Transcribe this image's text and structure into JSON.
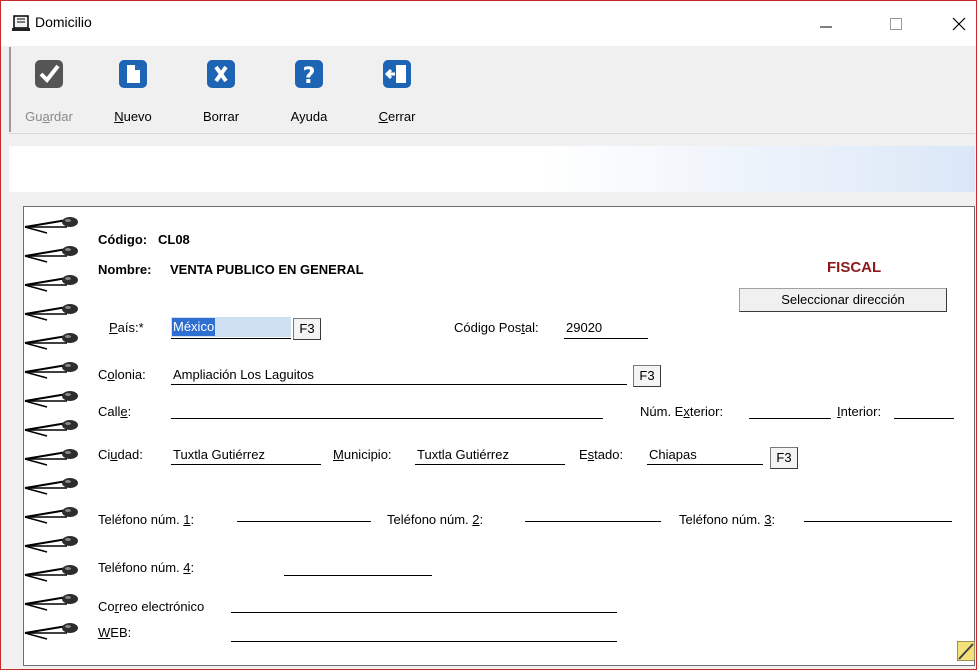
{
  "window": {
    "title": "Domicilio"
  },
  "toolbar": {
    "guardar": "Guardar",
    "nuevo": "Nuevo",
    "borrar": "Borrar",
    "ayuda": "Ayuda",
    "cerrar": "Cerrar"
  },
  "header": {
    "codigo_label": "Código:",
    "codigo_value": "CL08",
    "nombre_label": "Nombre:",
    "nombre_value": "VENTA PUBLICO EN GENERAL",
    "fiscal": "FISCAL",
    "select_address": "Seleccionar dirección"
  },
  "form": {
    "pais_label": "País:*",
    "pais_value": "México",
    "f3": "F3",
    "cp_label": "Código Postal:",
    "cp_value": "29020",
    "colonia_label": "Colonia:",
    "colonia_value": "Ampliación Los Laguitos",
    "calle_label": "Calle:",
    "calle_value": "",
    "num_ext_label": "Núm. Exterior:",
    "interior_label": "Interior:",
    "ciudad_label": "Ciudad:",
    "ciudad_value": "Tuxtla Gutiérrez",
    "municipio_label": "Municipio:",
    "municipio_value": "Tuxtla Gutiérrez",
    "estado_label": "Estado:",
    "estado_value": "Chiapas",
    "tel1_label": "Teléfono núm. 1:",
    "tel2_label": "Teléfono núm. 2:",
    "tel3_label": "Teléfono núm. 3:",
    "tel4_label": "Teléfono núm. 4:",
    "correo_label": "Correo electrónico",
    "web_label": "WEB:"
  },
  "colors": {
    "fiscal": "#8b1a1a",
    "icon_blue": "#1e64b4",
    "selection": "#2f6fd1"
  }
}
